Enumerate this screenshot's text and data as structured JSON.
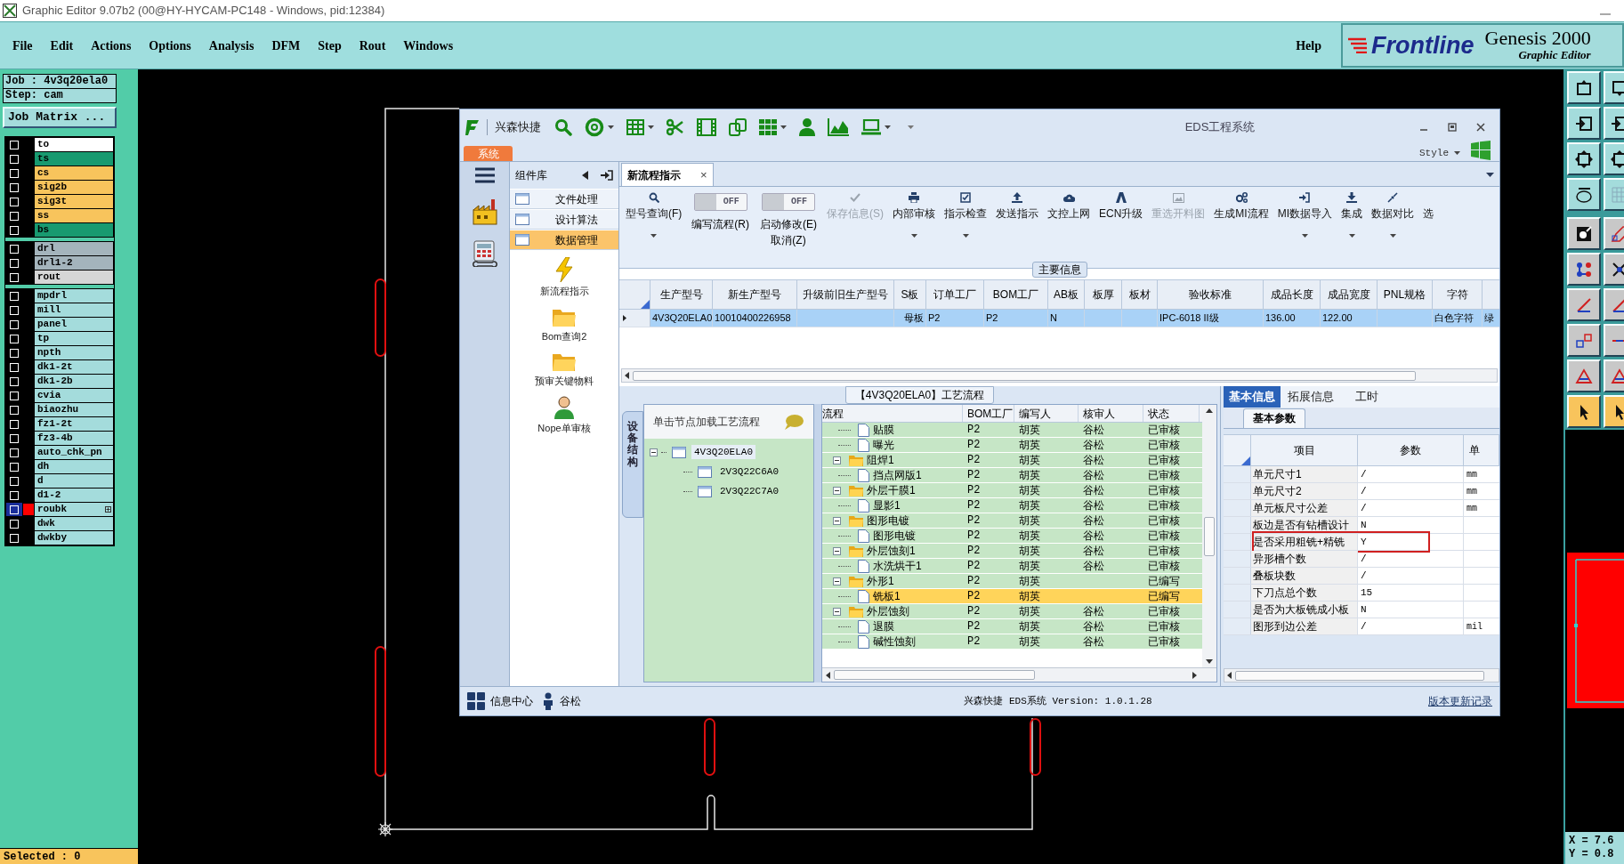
{
  "app_title": "Graphic Editor 9.07b2 (00@HY-HYCAM-PC148 - Windows, pid:12384)",
  "menu": [
    "File",
    "Edit",
    "Actions",
    "Options",
    "Analysis",
    "DFM",
    "Step",
    "Rout",
    "Windows"
  ],
  "help_menu": "Help",
  "brand": {
    "logo": "Frontline",
    "product": "Genesis 2000",
    "subtitle": "Graphic Editor"
  },
  "job": {
    "job": "Job : 4v3q20ela0",
    "step": "Step: cam",
    "matrix_button": "Job Matrix ..."
  },
  "layer_groups": [
    {
      "layers": [
        {
          "name": "to",
          "color": "#ffffff",
          "selected": false,
          "displayed": false,
          "expandable": false
        },
        {
          "name": "ts",
          "color": "#189a70",
          "selected": false,
          "displayed": false,
          "expandable": false
        },
        {
          "name": "cs",
          "color": "#f8c45c",
          "selected": false,
          "displayed": false,
          "expandable": false
        },
        {
          "name": "sig2b",
          "color": "#f8c45c",
          "selected": false,
          "displayed": false,
          "expandable": false
        },
        {
          "name": "sig3t",
          "color": "#f8c45c",
          "selected": false,
          "displayed": false,
          "expandable": false
        },
        {
          "name": "ss",
          "color": "#f8c45c",
          "selected": false,
          "displayed": false,
          "expandable": false
        },
        {
          "name": "bs",
          "color": "#189a70",
          "selected": false,
          "displayed": false,
          "expandable": false
        }
      ]
    },
    {
      "layers": [
        {
          "name": "drl",
          "color": "#a4b4bc",
          "selected": false,
          "displayed": false,
          "expandable": false
        },
        {
          "name": "drl1-2",
          "color": "#a4b4bc",
          "selected": false,
          "displayed": false,
          "expandable": false
        },
        {
          "name": "rout",
          "color": "#d6d6d6",
          "selected": false,
          "displayed": false,
          "expandable": false
        }
      ]
    },
    {
      "layers": [
        {
          "name": "mpdrl",
          "color": "#a4dcdc",
          "selected": false,
          "displayed": false,
          "expandable": false
        },
        {
          "name": "mill",
          "color": "#a4dcdc",
          "selected": false,
          "displayed": false,
          "expandable": false
        },
        {
          "name": "panel",
          "color": "#a4dcdc",
          "selected": false,
          "displayed": false,
          "expandable": false
        },
        {
          "name": "tp",
          "color": "#a4dcdc",
          "selected": false,
          "displayed": false,
          "expandable": false
        },
        {
          "name": "npth",
          "color": "#a4dcdc",
          "selected": false,
          "displayed": false,
          "expandable": false
        },
        {
          "name": "dk1-2t",
          "color": "#a4dcdc",
          "selected": false,
          "displayed": false,
          "expandable": false
        },
        {
          "name": "dk1-2b",
          "color": "#a4dcdc",
          "selected": false,
          "displayed": false,
          "expandable": false
        },
        {
          "name": "cvia",
          "color": "#a4dcdc",
          "selected": false,
          "displayed": false,
          "expandable": false
        },
        {
          "name": "biaozhu",
          "color": "#a4dcdc",
          "selected": false,
          "displayed": false,
          "expandable": false
        },
        {
          "name": "fz1-2t",
          "color": "#a4dcdc",
          "selected": false,
          "displayed": false,
          "expandable": false
        },
        {
          "name": "fz3-4b",
          "color": "#a4dcdc",
          "selected": false,
          "displayed": false,
          "expandable": false
        },
        {
          "name": "auto_chk_pn",
          "color": "#a4dcdc",
          "selected": false,
          "displayed": false,
          "expandable": false
        },
        {
          "name": "dh",
          "color": "#a4dcdc",
          "selected": false,
          "displayed": false,
          "expandable": false
        },
        {
          "name": "d",
          "color": "#a4dcdc",
          "selected": false,
          "displayed": false,
          "expandable": false
        },
        {
          "name": "d1-2",
          "color": "#a4dcdc",
          "selected": false,
          "displayed": false,
          "expandable": false
        },
        {
          "name": "roubk",
          "color": "#a4dcdc",
          "selected": true,
          "displayed": true,
          "expandable": true
        },
        {
          "name": "dwk",
          "color": "#a4dcdc",
          "selected": false,
          "displayed": false,
          "expandable": false
        },
        {
          "name": "dwkby",
          "color": "#a4dcdc",
          "selected": false,
          "displayed": false,
          "expandable": false
        }
      ]
    }
  ],
  "selected_count": "Selected : 0",
  "coordinates": [
    "X = 7.6",
    "Y = 0.8"
  ],
  "eds": {
    "app_name": "兴森快捷",
    "title": "EDS工程系统",
    "system_tab": "系统",
    "style_menu": "Style",
    "component_library": {
      "title": "组件库",
      "items": [
        {
          "label": "文件处理",
          "selected": false
        },
        {
          "label": "设计算法",
          "selected": false
        },
        {
          "label": "数据管理",
          "selected": true
        }
      ],
      "launchers": [
        "新流程指示",
        "Bom查询2",
        "预审关键物料",
        "Nope单审核"
      ]
    },
    "doc_tab": {
      "label": "新流程指示",
      "close": "×"
    },
    "ribbon": [
      {
        "kind": "button",
        "label": "型号查询(F)",
        "disabled": false,
        "dropdown": true
      },
      {
        "kind": "toggle",
        "label": "编写流程(R)",
        "switch": "OFF",
        "on": false
      },
      {
        "kind": "toggle",
        "label": "启动修改(E)",
        "sublabel": "取消(Z)",
        "switch": "OFF",
        "on": false
      },
      {
        "kind": "button",
        "label": "保存信息(S)",
        "disabled": true,
        "dropdown": false
      },
      {
        "kind": "button",
        "label": "内部审核",
        "disabled": false,
        "dropdown": true
      },
      {
        "kind": "button",
        "label": "指示检查",
        "disabled": false,
        "dropdown": true
      },
      {
        "kind": "button",
        "label": "发送指示",
        "disabled": false,
        "dropdown": false
      },
      {
        "kind": "button",
        "label": "文控上网",
        "disabled": false,
        "dropdown": false
      },
      {
        "kind": "button",
        "label": "ECN升级",
        "disabled": false,
        "dropdown": false
      },
      {
        "kind": "button",
        "label": "重选开料图",
        "disabled": true,
        "dropdown": false
      },
      {
        "kind": "button",
        "label": "生成MI流程",
        "disabled": false,
        "dropdown": false
      },
      {
        "kind": "button",
        "label": "MI数据导入",
        "disabled": false,
        "dropdown": true
      },
      {
        "kind": "button",
        "label": "集成",
        "disabled": false,
        "dropdown": true
      },
      {
        "kind": "button",
        "label": "数据对比",
        "disabled": false,
        "dropdown": true
      },
      {
        "kind": "button",
        "label": "选",
        "disabled": false,
        "dropdown": false
      }
    ],
    "main_info": {
      "title": "主要信息",
      "columns": [
        "生产型号",
        "新生产型号",
        "升级前旧生产型号",
        "S板",
        "订单工厂",
        "BOM工厂",
        "AB板",
        "板厚",
        "板材",
        "验收标准",
        "成品长度",
        "成品宽度",
        "PNL规格",
        "字符"
      ],
      "rows": [
        {
          "selected": true,
          "cells": [
            "4V3Q20ELA0",
            "10010400226958",
            "",
            "母板",
            "P2",
            "P2",
            "N",
            "",
            "",
            "IPC-6018 II级",
            "136.00",
            "122.00",
            "",
            "白色字符",
            "绿"
          ]
        }
      ]
    },
    "process": {
      "title": "【4V3Q20ELA0】工艺流程",
      "side_tab": "设备结构",
      "tree_hint": "单击节点加载工艺流程",
      "tree": [
        {
          "label": "4V3Q20ELA0",
          "expanded": true,
          "children": [
            {
              "label": "2V3Q22C6A0"
            },
            {
              "label": "2V3Q22C7A0"
            }
          ]
        }
      ],
      "columns": [
        "流程",
        "BOM工厂",
        "编写人",
        "核审人",
        "状态"
      ],
      "rows": [
        {
          "kind": "file",
          "name": "贴膜",
          "bom": "P2",
          "writer": "胡英",
          "reviewer": "谷松",
          "status": "已审核",
          "selected": false
        },
        {
          "kind": "file",
          "name": "曝光",
          "bom": "P2",
          "writer": "胡英",
          "reviewer": "谷松",
          "status": "已审核",
          "selected": false
        },
        {
          "kind": "folder",
          "name": "阻焊1",
          "bom": "P2",
          "writer": "胡英",
          "reviewer": "谷松",
          "status": "已审核",
          "selected": false,
          "expanded": true,
          "children": [
            {
              "kind": "file",
              "name": "挡点网版1",
              "bom": "P2",
              "writer": "胡英",
              "reviewer": "谷松",
              "status": "已审核",
              "selected": false
            }
          ]
        },
        {
          "kind": "folder",
          "name": "外层干膜1",
          "bom": "P2",
          "writer": "胡英",
          "reviewer": "谷松",
          "status": "已审核",
          "selected": false,
          "expanded": true,
          "children": [
            {
              "kind": "file",
              "name": "显影1",
              "bom": "P2",
              "writer": "胡英",
              "reviewer": "谷松",
              "status": "已审核",
              "selected": false
            }
          ]
        },
        {
          "kind": "folder",
          "name": "图形电镀",
          "bom": "P2",
          "writer": "胡英",
          "reviewer": "谷松",
          "status": "已审核",
          "selected": false,
          "expanded": true,
          "children": [
            {
              "kind": "file",
              "name": "图形电镀",
              "bom": "P2",
              "writer": "胡英",
              "reviewer": "谷松",
              "status": "已审核",
              "selected": false
            }
          ]
        },
        {
          "kind": "folder",
          "name": "外层蚀刻1",
          "bom": "P2",
          "writer": "胡英",
          "reviewer": "谷松",
          "status": "已审核",
          "selected": false,
          "expanded": true,
          "children": [
            {
              "kind": "file",
              "name": "水洗烘干1",
              "bom": "P2",
              "writer": "胡英",
              "reviewer": "谷松",
              "status": "已审核",
              "selected": false
            }
          ]
        },
        {
          "kind": "folder",
          "name": "外形1",
          "bom": "P2",
          "writer": "胡英",
          "status": "已编写",
          "selected": false,
          "expanded": true,
          "children": [
            {
              "kind": "file",
              "name": "铣板1",
              "bom": "P2",
              "writer": "胡英",
              "status": "已编写",
              "selected": true
            }
          ]
        },
        {
          "kind": "folder",
          "name": "外层蚀刻",
          "bom": "P2",
          "writer": "胡英",
          "reviewer": "谷松",
          "status": "已审核",
          "selected": false,
          "expanded": true,
          "children": [
            {
              "kind": "file",
              "name": "退膜",
              "bom": "P2",
              "writer": "胡英",
              "reviewer": "谷松",
              "status": "已审核",
              "selected": false
            },
            {
              "kind": "file",
              "name": "碱性蚀刻",
              "bom": "P2",
              "writer": "胡英",
              "reviewer": "谷松",
              "status": "已审核",
              "selected": false
            }
          ]
        }
      ]
    },
    "details": {
      "tabs": [
        {
          "label": "基本信息",
          "selected": true
        },
        {
          "label": "拓展信息",
          "selected": false
        },
        {
          "label": "工时",
          "selected": false
        }
      ],
      "sub_tab": "基本参数",
      "columns": [
        "项目",
        "参数",
        "单"
      ],
      "rows": [
        {
          "item": "单元尺寸1",
          "value": "/",
          "unit": "mm",
          "highlighted": false
        },
        {
          "item": "单元尺寸2",
          "value": "/",
          "unit": "mm",
          "highlighted": false
        },
        {
          "item": "单元板尺寸公差",
          "value": "/",
          "unit": "mm",
          "highlighted": false
        },
        {
          "item": "板边是否有钻槽设计",
          "value": "N",
          "highlighted": false
        },
        {
          "item": "是否采用粗铣+精铣",
          "value": "Y",
          "highlighted": true
        },
        {
          "item": "异形槽个数",
          "value": "/",
          "highlighted": false
        },
        {
          "item": "叠板块数",
          "value": "/",
          "highlighted": false
        },
        {
          "item": "下刀点总个数",
          "value": "15",
          "highlighted": false
        },
        {
          "item": "是否为大板铣成小板",
          "value": "N",
          "highlighted": false
        },
        {
          "item": "图形到边公差",
          "value": "/",
          "unit": "mil",
          "highlighted": false
        }
      ]
    },
    "status_bar": {
      "info_center": "信息中心",
      "user": "谷松",
      "version": "兴森快捷 EDS系统 Version: 1.0.1.28",
      "changelog": "版本更新记录"
    }
  }
}
